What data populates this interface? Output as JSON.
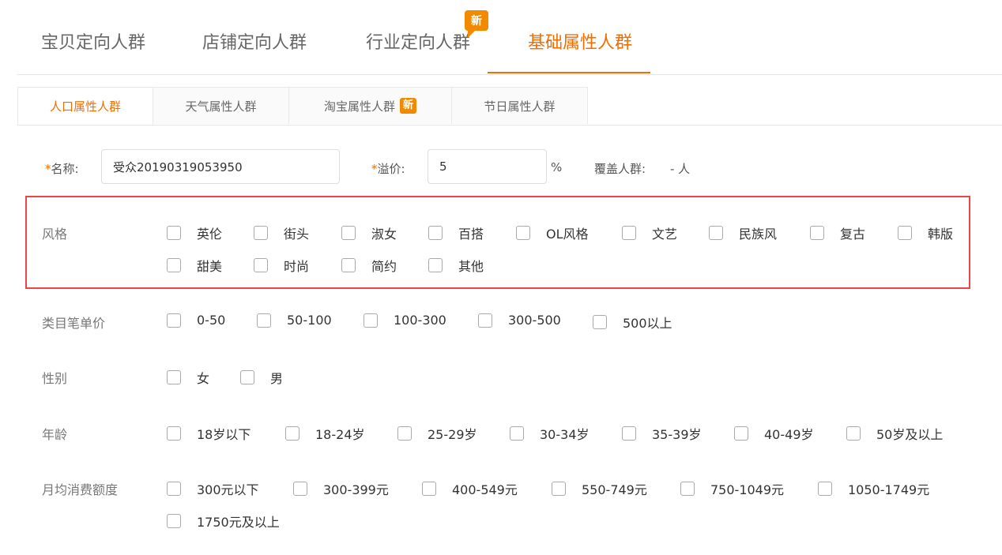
{
  "top_tabs": [
    {
      "label": "宝贝定向人群"
    },
    {
      "label": "店铺定向人群"
    },
    {
      "label": "行业定向人群",
      "badge": "新"
    },
    {
      "label": "基础属性人群"
    }
  ],
  "sub_tabs": [
    {
      "label": "人口属性人群"
    },
    {
      "label": "天气属性人群"
    },
    {
      "label": "淘宝属性人群",
      "badge": "新"
    },
    {
      "label": "节日属性人群"
    }
  ],
  "form": {
    "required_mark": "*",
    "name_label": "名称:",
    "name_value": "受众20190319053950",
    "premium_label": "溢价:",
    "premium_value": "5",
    "percent": "%",
    "coverage_label": "覆盖人群:",
    "coverage_value": "- 人"
  },
  "groups": {
    "style": {
      "label": "风格",
      "options": [
        "英伦",
        "街头",
        "淑女",
        "百搭",
        "OL风格",
        "文艺",
        "民族风",
        "复古",
        "韩版",
        "甜美",
        "时尚",
        "简约",
        "其他"
      ]
    },
    "price": {
      "label": "类目笔单价",
      "options": [
        "0-50",
        "50-100",
        "100-300",
        "300-500",
        "500以上"
      ]
    },
    "gender": {
      "label": "性别",
      "options": [
        "女",
        "男"
      ]
    },
    "age": {
      "label": "年龄",
      "options": [
        "18岁以下",
        "18-24岁",
        "25-29岁",
        "30-34岁",
        "35-39岁",
        "40-49岁",
        "50岁及以上"
      ]
    },
    "spend": {
      "label": "月均消费额度",
      "options": [
        "300元以下",
        "300-399元",
        "400-549元",
        "550-749元",
        "750-1049元",
        "1050-1749元",
        "1750元及以上"
      ]
    }
  }
}
